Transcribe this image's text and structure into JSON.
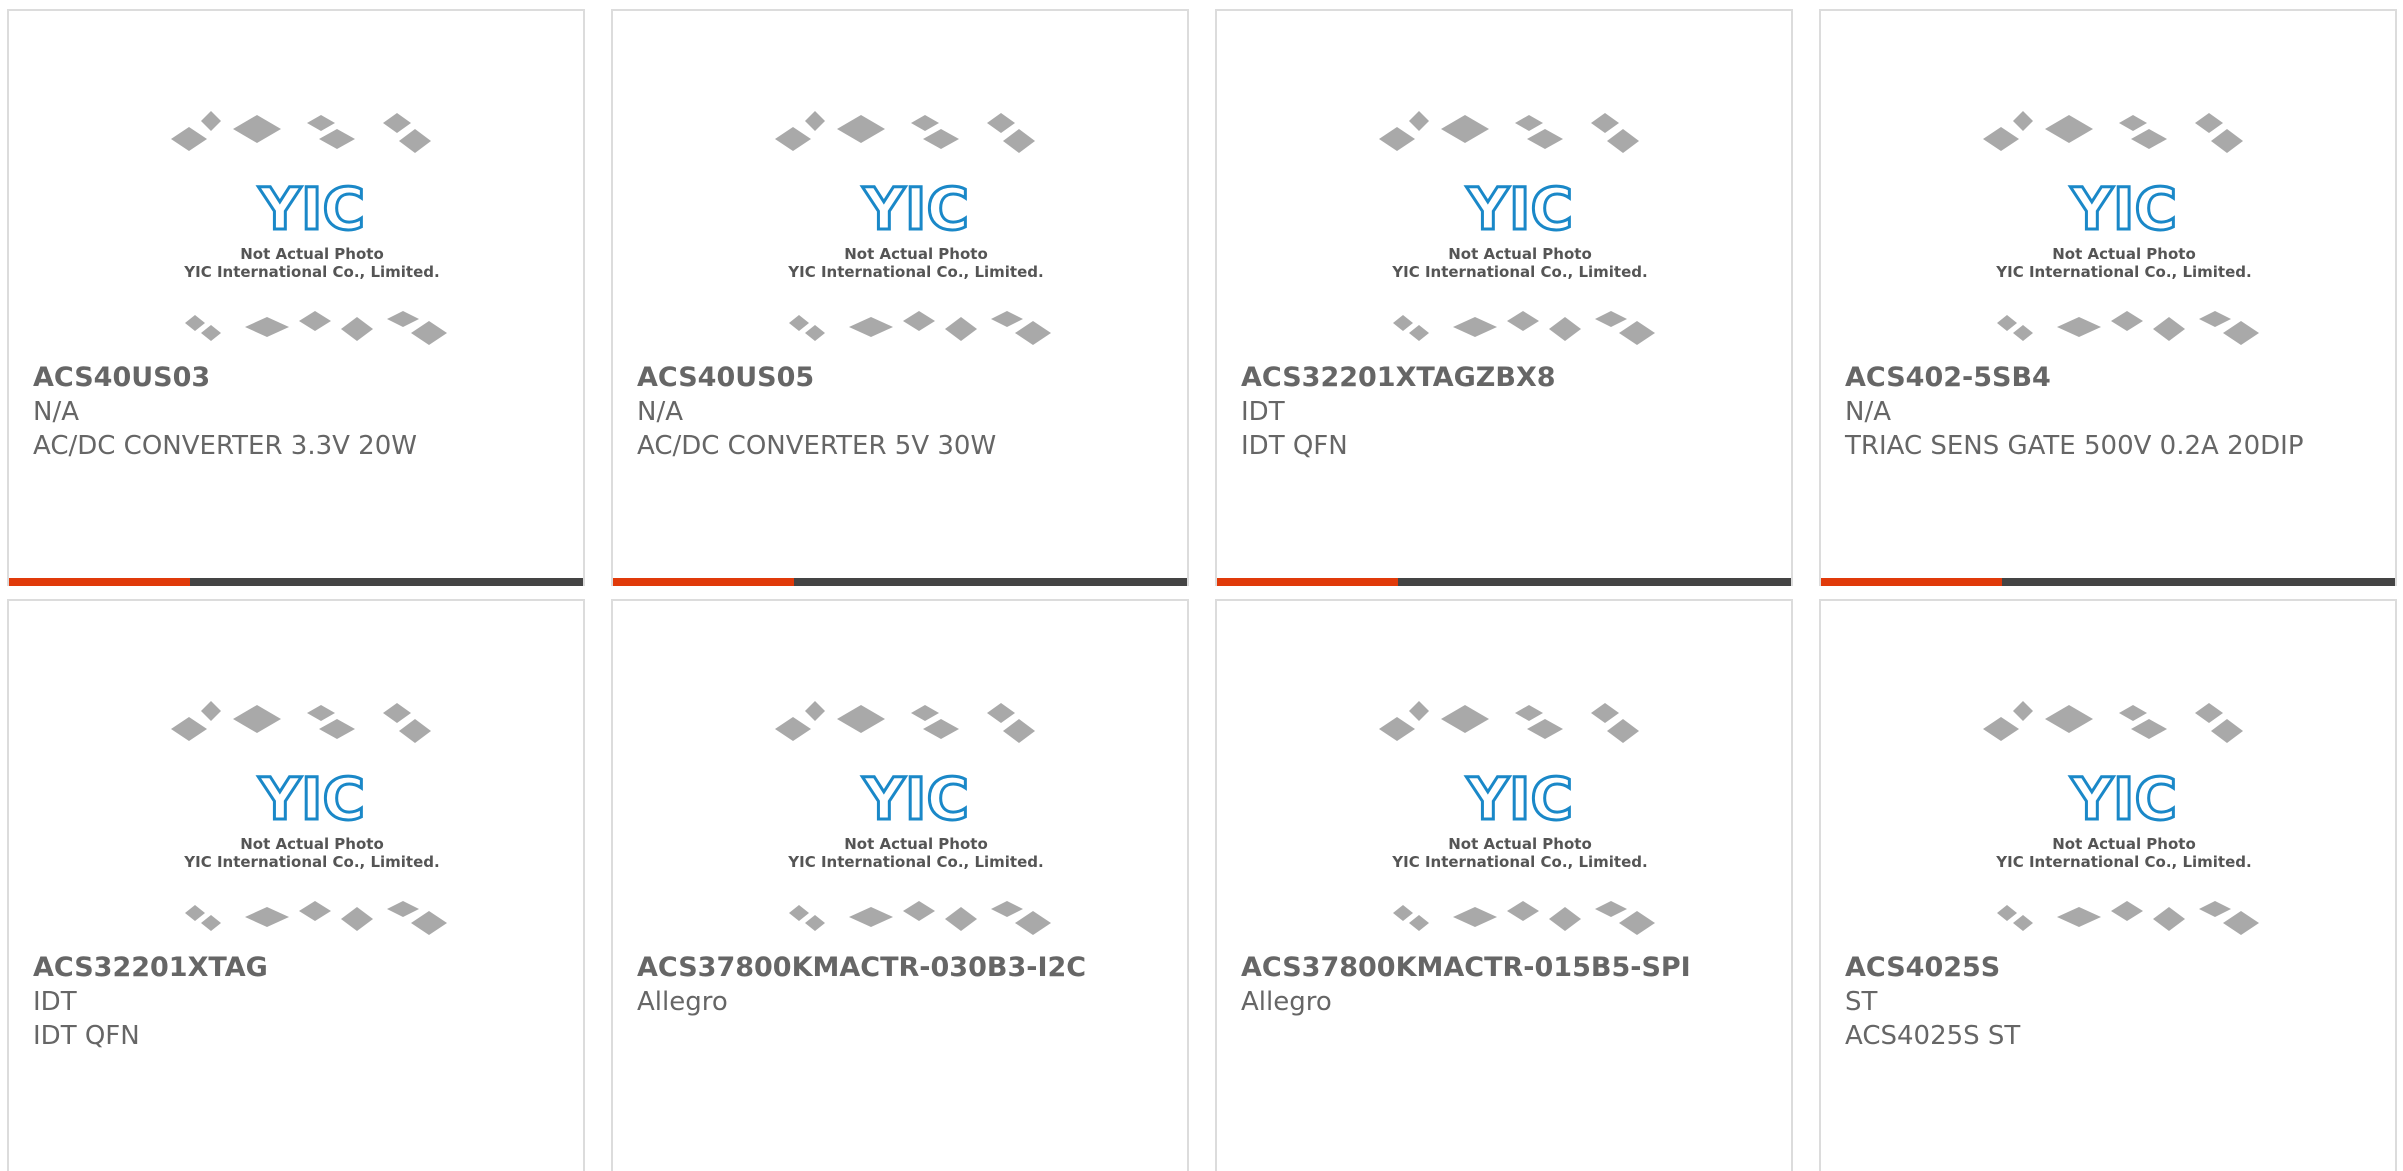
{
  "photo": {
    "caption_line1": "Not Actual Photo",
    "caption_line2": "YIC International Co., Limited.",
    "logo_text": "YIC",
    "logo_color": "#1a88c8",
    "chip_color": "#a9a9a9"
  },
  "colors": {
    "accent": "#e03a0a",
    "bar": "#444444",
    "text": "#666666"
  },
  "products": [
    {
      "part": "ACS40US03",
      "manufacturer": "N/A",
      "description": "AC/DC CONVERTER 3.3V 20W"
    },
    {
      "part": "ACS40US05",
      "manufacturer": "N/A",
      "description": "AC/DC CONVERTER 5V 30W"
    },
    {
      "part": "ACS32201XTAGZBX8",
      "manufacturer": "IDT",
      "description": "IDT QFN"
    },
    {
      "part": "ACS402-5SB4",
      "manufacturer": "N/A",
      "description": "TRIAC SENS GATE 500V 0.2A 20DIP"
    },
    {
      "part": "ACS32201XTAG",
      "manufacturer": "IDT",
      "description": "IDT QFN"
    },
    {
      "part": "ACS37800KMACTR-030B3-I2C",
      "manufacturer": "Allegro",
      "description": ""
    },
    {
      "part": "ACS37800KMACTR-015B5-SPI",
      "manufacturer": "Allegro",
      "description": ""
    },
    {
      "part": "ACS4025S",
      "manufacturer": "ST",
      "description": "ACS4025S ST"
    }
  ]
}
